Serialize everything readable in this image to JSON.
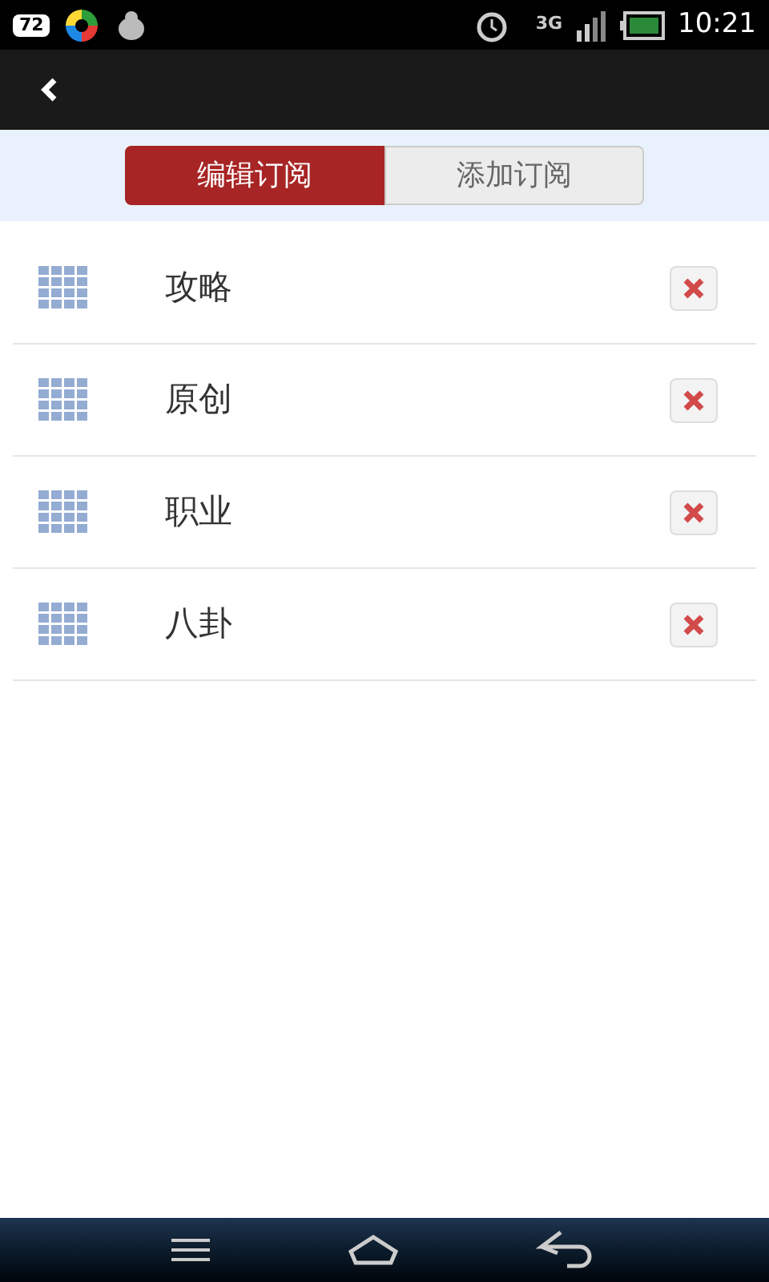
{
  "status_bar": {
    "notification_count": "72",
    "network": "3G",
    "time": "10:21"
  },
  "tabs": [
    {
      "label": "编辑订阅",
      "selected": true
    },
    {
      "label": "添加订阅",
      "selected": false
    }
  ],
  "subscriptions": [
    {
      "name": "攻略"
    },
    {
      "name": "原创"
    },
    {
      "name": "职业"
    },
    {
      "name": "八卦"
    }
  ]
}
